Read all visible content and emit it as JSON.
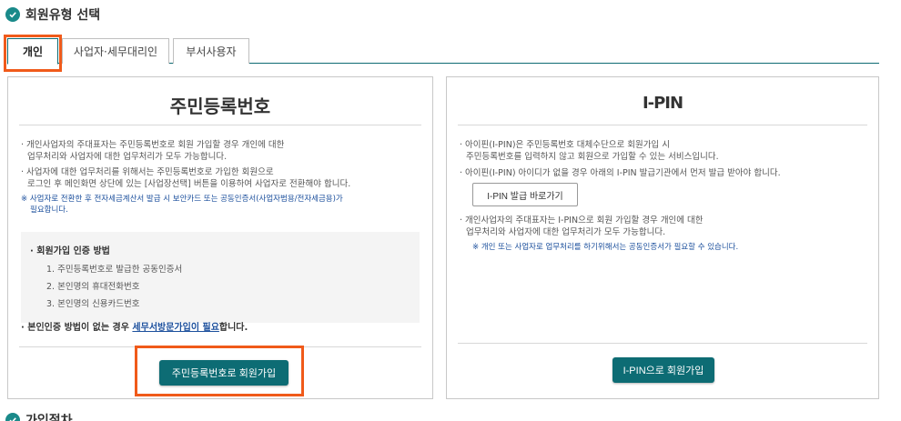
{
  "section": {
    "title": "회원유형 선택"
  },
  "tabs": [
    {
      "label": "개인",
      "active": true
    },
    {
      "label": "사업자·세무대리인",
      "active": false
    },
    {
      "label": "부서사용자",
      "active": false
    }
  ],
  "left_panel": {
    "title": "주민등록번호",
    "desc1_line1": "개인사업자의 주대표자는 주민등록번호로 회원 가입할 경우 개인에 대한",
    "desc1_line2": "업무처리와 사업자에 대한 업무처리가 모두 가능합니다.",
    "desc2_line1": "사업자에 대한 업무처리를 위해서는 주민등록번호로 가입한 회원으로",
    "desc2_line2": "로그인 후 메인화면 상단에 있는 [사업장선택] 버튼을 이용하여 사업자로 전환해야 합니다.",
    "note_line1": "※ 사업자로 전환한 후 전자세금계산서 발급 시 보안카드 또는 공동인증서(사업자범용/전자세금용)가",
    "note_line2": "필요합니다.",
    "method_title": "회원가입 인증 방법",
    "methods": [
      "1. 주민등록번호로 발급한 공동인증서",
      "2. 본인명의 휴대전화번호",
      "3. 본인명의 신용카드번호"
    ],
    "no_auth_prefix": "본인인증 방법이 없는 경우",
    "no_auth_link": "세무서방문가입이 필요",
    "no_auth_suffix": "합니다.",
    "button": "주민등록번호로 회원가입"
  },
  "right_panel": {
    "title": "I-PIN",
    "desc1_line1": "아이핀(I-PIN)은 주민등록번호 대체수단으로 회원가입 시",
    "desc1_line2": "주민등록번호를 입력하지 않고 회원으로 가입할 수 있는 서비스입니다.",
    "desc2": "아이핀(I-PIN) 아이디가 없을 경우 아래의 I-PIN 발급기관에서 먼저 발급 받아야 합니다.",
    "issue_button": "I-PIN 발급 바로가기",
    "desc3_line1": "개인사업자의 주대표자는 I-PIN으로 회원 가입할 경우 개인에 대한",
    "desc3_line2": "업무처리와 사업자에 대한 업무처리가 모두 가능합니다.",
    "note": "※ 개인 또는 사업자로 업무처리를 하기위해서는 공동인증서가 필요할 수 있습니다.",
    "button": "I-PIN으로 회원가입"
  },
  "next_section": {
    "title": "가입절차"
  },
  "colors": {
    "accent": "#0d6c74",
    "highlight": "#f05a1a",
    "check": "#1a8a8a",
    "link": "#1b4f9c"
  }
}
